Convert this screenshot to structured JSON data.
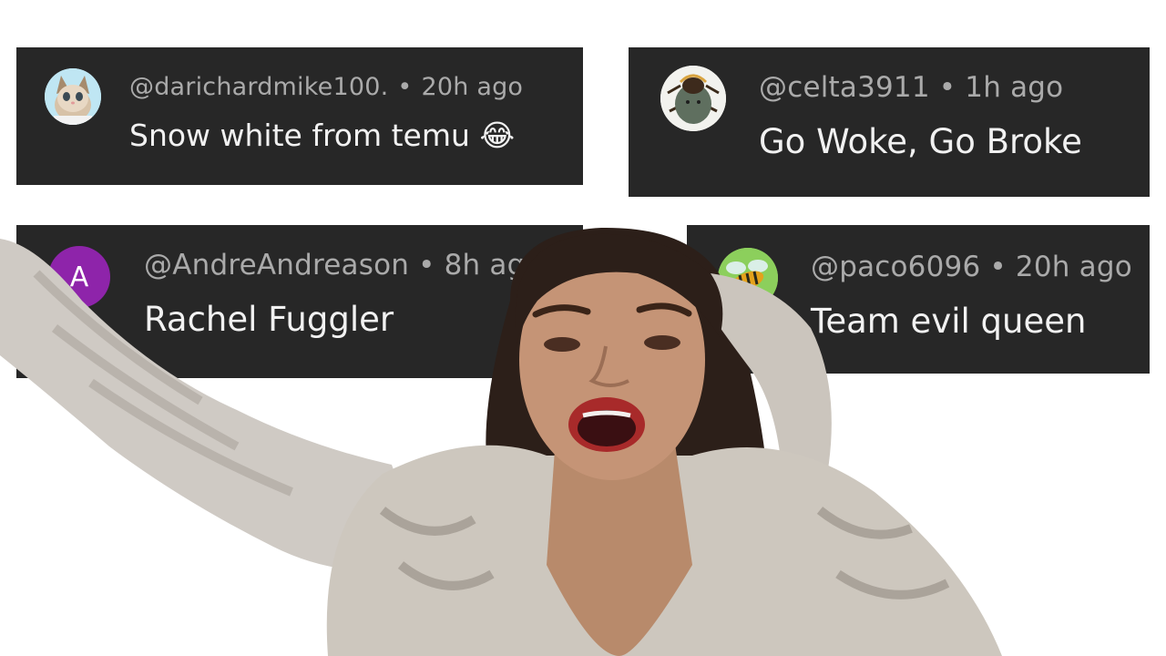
{
  "comments": [
    {
      "handle": "@darichardmike100.",
      "separator": "•",
      "time": "20h ago",
      "text": "Snow white from temu",
      "emoji": "😂",
      "avatar": "kitten-avatar"
    },
    {
      "handle": "@celta3911",
      "separator": "•",
      "time": "1h ago",
      "text": "Go Woke, Go Broke",
      "avatar": "beetle-avatar"
    },
    {
      "handle": "@AndreAndreason",
      "separator": "•",
      "time": "8h ago",
      "text": "Rachel Fuggler",
      "avatar_letter": "A",
      "avatar_color": "#8e24aa"
    },
    {
      "handle": "@paco6096",
      "separator": "•",
      "time": "20h ago",
      "text": "Team evil queen",
      "avatar": "bee-avatar"
    }
  ],
  "colors": {
    "card_background": "#272727",
    "handle_text": "#aaaaaa",
    "comment_text": "#f1f1f1",
    "page_background": "#ffffff"
  }
}
